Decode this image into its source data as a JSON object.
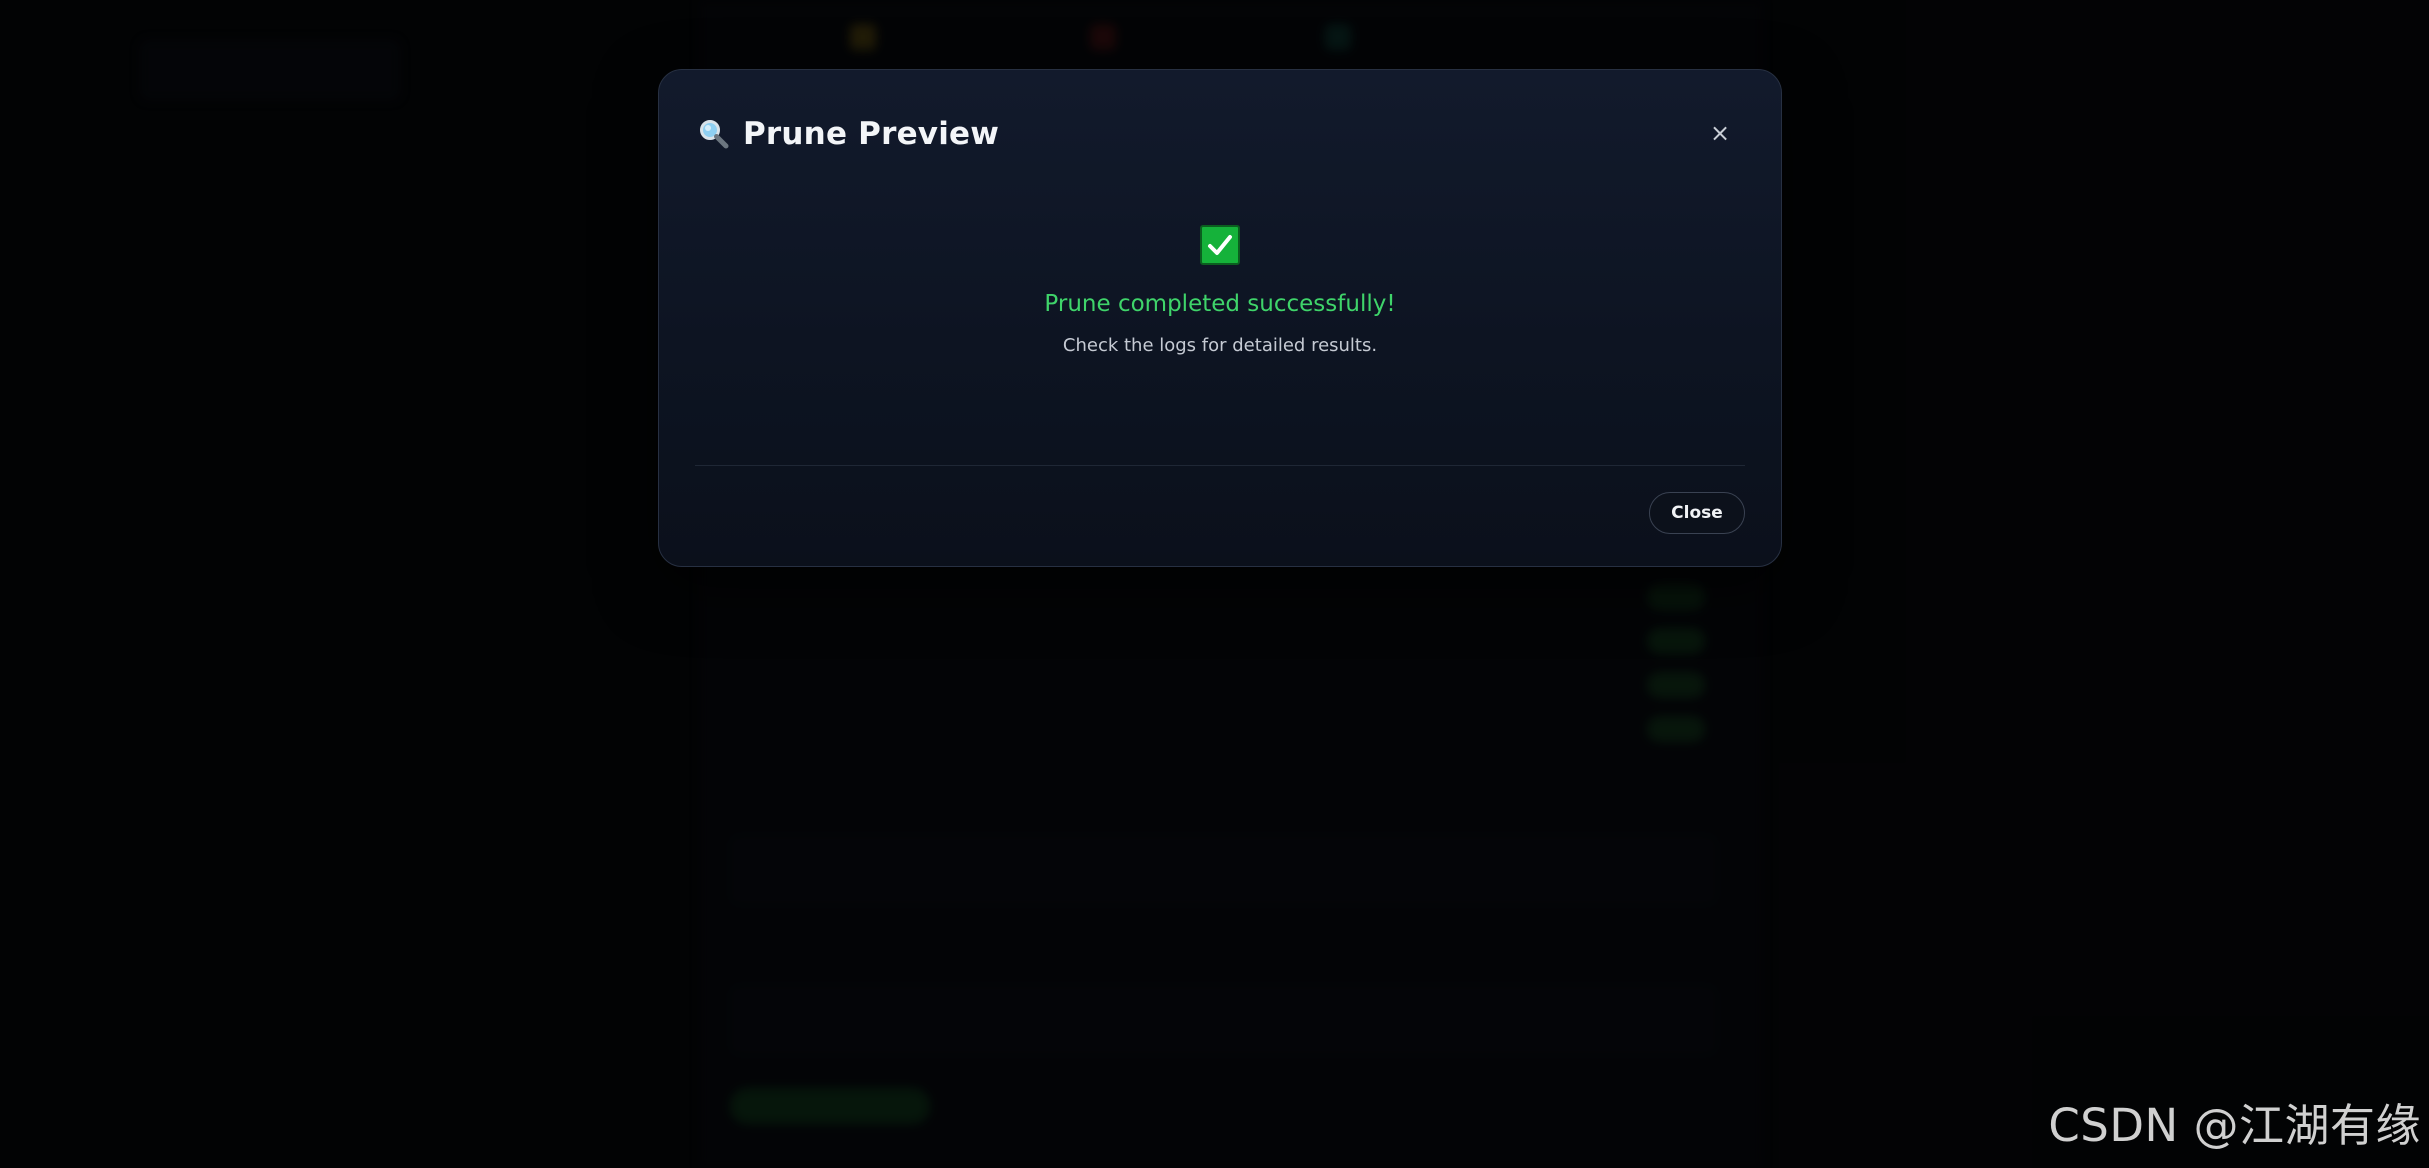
{
  "modal": {
    "title": "Prune Preview",
    "close_symbol": "×",
    "success_message": "Prune completed successfully!",
    "detail_message": "Check the logs for detailed results.",
    "close_button_label": "Close",
    "success_color": "#3fd46a",
    "icons": {
      "title": "search-icon",
      "status": "check-mark-icon",
      "dismiss": "close-icon"
    }
  },
  "watermark": {
    "text": "CSDN @江湖有缘"
  }
}
